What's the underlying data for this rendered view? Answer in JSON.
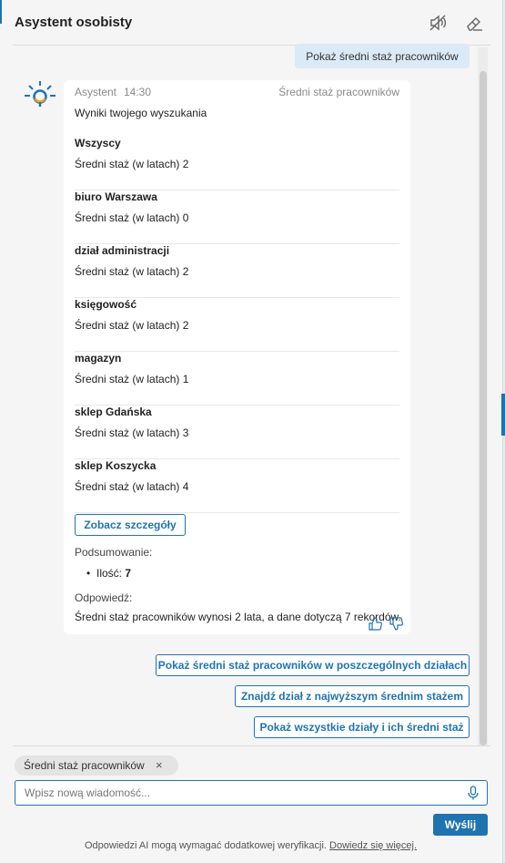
{
  "header": {
    "title": "Asystent osobisty",
    "mute_icon": "speaker-muted-icon",
    "clear_icon": "eraser-icon"
  },
  "user_message": "Pokaż średni staż pracowników",
  "assistant": {
    "avatar_icon": "assistant-lightbulb-icon",
    "name": "Asystent",
    "time": "14:30",
    "topic": "Średni staż pracowników",
    "intro": "Wyniki twojego wyszukania",
    "results": [
      {
        "name": "Wszyscy",
        "value": "Średni staż (w latach) 2"
      },
      {
        "name": "biuro Warszawa",
        "value": "Średni staż (w latach) 0"
      },
      {
        "name": "dział administracji",
        "value": "Średni staż (w latach) 2"
      },
      {
        "name": "księgowość",
        "value": "Średni staż (w latach) 2"
      },
      {
        "name": "magazyn",
        "value": "Średni staż (w latach) 1"
      },
      {
        "name": "sklep Gdańska",
        "value": "Średni staż (w latach) 3"
      },
      {
        "name": "sklep Koszycka",
        "value": "Średni staż (w latach) 4"
      }
    ],
    "details_button": "Zobacz szczegóły",
    "summary_label": "Podsumowanie:",
    "summary_item_label": "Ilość:",
    "summary_item_value": "7",
    "answer_label": "Odpowiedź:",
    "answer_text": "Średni staż pracowników wynosi 2 lata, a dane dotyczą 7 rekordów."
  },
  "suggestions": [
    "Pokaż średni staż pracowników w poszczególnych działach",
    "Znajdź dział z najwyższym średnim stażem",
    "Pokaż wszystkie działy i ich średni staż"
  ],
  "context_chip": {
    "label": "Średni staż pracowników",
    "close": "×"
  },
  "input": {
    "placeholder": "Wpisz nową wiadomość..."
  },
  "send_button": "Wyślij",
  "disclaimer": {
    "text": "Odpowiedzi AI mogą wymagać dodatkowej weryfikacji.",
    "link": "Dowiedz się więcej."
  },
  "colors": {
    "accent": "#1f74b0",
    "user_bubble": "#dbeaf7",
    "avatar_ring": "#f39a1e"
  }
}
